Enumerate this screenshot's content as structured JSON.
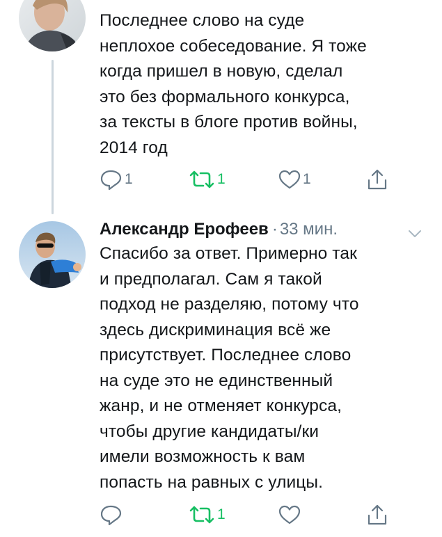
{
  "colors": {
    "text": "#14171a",
    "secondary": "#657786",
    "retweet_active": "#17bf63",
    "thread_line": "#ccd6dd"
  },
  "tweets": [
    {
      "author": "",
      "time": "",
      "text": "Последнее слово на суде\nнеплохое собеседование. Я тоже\nкогда пришел в новую,  сделал\nэто без формального конкурса,\nза тексты в блоге против войны,\n2014 год",
      "reply_count": "1",
      "retweet_count": "1",
      "like_count": "1",
      "retweeted": true
    },
    {
      "author": "Александр Ерофеев",
      "separator": "·",
      "time": "33 мин.",
      "text": "Спасибо за ответ. Примерно так\nи предполагал. Сам я такой\nподход не разделяю, потому что\nздесь дискриминация всё же\nприсутствует. Последнее слово\nна суде это не единственный\nжанр, и не отменяет конкурса,\nчтобы другие кандидаты/ки\nимели возможность к вам\nпопасть на равных с улицы.",
      "reply_count": "",
      "retweet_count": "1",
      "like_count": "",
      "retweeted": true
    }
  ],
  "icons": {
    "reply": "reply-bubble-icon",
    "retweet": "retweet-arrows-icon",
    "like": "heart-icon",
    "share": "share-upload-icon",
    "more": "chevron-down-icon"
  }
}
